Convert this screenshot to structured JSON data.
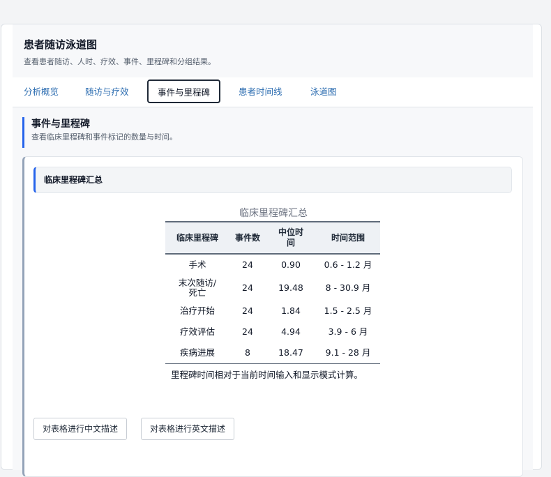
{
  "header": {
    "title": "患者随访泳道图",
    "subtitle": "查看患者随访、人时、疗效、事件、里程碑和分组结果。"
  },
  "tabs": [
    {
      "label": "分析概览"
    },
    {
      "label": "随访与疗效"
    },
    {
      "label": "事件与里程碑",
      "active": true
    },
    {
      "label": "患者时间线"
    },
    {
      "label": "泳道图"
    }
  ],
  "section": {
    "title": "事件与里程碑",
    "subtitle": "查看临床里程碑和事件标记的数量与时间。"
  },
  "card": {
    "title": "临床里程碑汇总"
  },
  "table": {
    "caption": "临床里程碑汇总",
    "columns": [
      "临床里程碑",
      "事件数",
      "中位时间",
      "时间范围"
    ],
    "rows": [
      [
        "手术",
        "24",
        "0.90",
        "0.6 - 1.2 月"
      ],
      [
        "末次随访/死亡",
        "24",
        "19.48",
        "8 - 30.9 月"
      ],
      [
        "治疗开始",
        "24",
        "1.84",
        "1.5 - 2.5 月"
      ],
      [
        "疗效评估",
        "24",
        "4.94",
        "3.9 - 6 月"
      ],
      [
        "疾病进展",
        "8",
        "18.47",
        "9.1 - 28 月"
      ]
    ],
    "footnote": "里程碑时间相对于当前时间输入和显示模式计算。"
  },
  "buttons": {
    "describe_cn": "对表格进行中文描述",
    "describe_en": "对表格进行英文描述"
  },
  "colors": {
    "accent": "#2563eb",
    "tab_link": "#2b6cb0",
    "table_rule": "#5f6b7a"
  }
}
